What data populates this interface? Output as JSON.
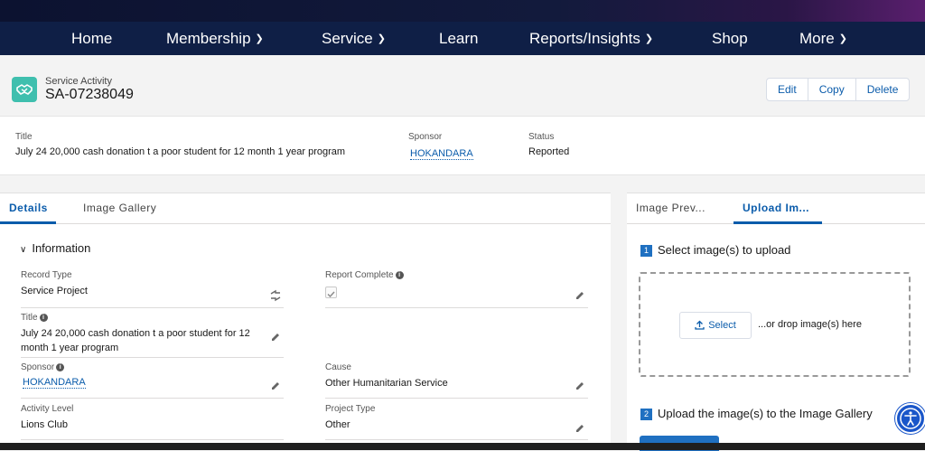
{
  "nav": {
    "items": [
      {
        "label": "Home",
        "dropdown": false
      },
      {
        "label": "Membership",
        "dropdown": true
      },
      {
        "label": "Service",
        "dropdown": true
      },
      {
        "label": "Learn",
        "dropdown": false
      },
      {
        "label": "Reports/Insights",
        "dropdown": true
      },
      {
        "label": "Shop",
        "dropdown": false
      },
      {
        "label": "More",
        "dropdown": true
      }
    ]
  },
  "record": {
    "type_label": "Service Activity",
    "id": "SA-07238049",
    "icon": "handshake-icon",
    "actions": [
      "Edit",
      "Copy",
      "Delete"
    ]
  },
  "highlights": {
    "title_label": "Title",
    "title_value": "July 24 20,000 cash donation t a poor student for 12 month 1 year program",
    "sponsor_label": "Sponsor",
    "sponsor_value": "HOKANDARA",
    "status_label": "Status",
    "status_value": "Reported"
  },
  "details": {
    "tabs": [
      "Details",
      "Image Gallery"
    ],
    "active_tab": "Details",
    "section_title": "Information",
    "fields": {
      "record_type_label": "Record Type",
      "record_type_value": "Service Project",
      "report_complete_label": "Report Complete",
      "report_complete_checked": true,
      "title_label": "Title",
      "title_value_line1": "July 24 20,000 cash donation t a poor student for 12",
      "title_value_line2": "month 1 year program",
      "sponsor_label": "Sponsor",
      "sponsor_value": "HOKANDARA",
      "cause_label": "Cause",
      "cause_value": "Other Humanitarian Service",
      "activity_level_label": "Activity Level",
      "activity_level_value": "Lions Club",
      "project_type_label": "Project Type",
      "project_type_value": "Other"
    }
  },
  "upload": {
    "tabs": [
      "Image Prev...",
      "Upload Im..."
    ],
    "active_tab": "Upload Im...",
    "step1_num": "1",
    "step1_label": "Select image(s) to upload",
    "select_label": "Select",
    "drop_text": "...or drop image(s) here",
    "step2_num": "2",
    "step2_label": "Upload the image(s) to the Image Gallery"
  },
  "colors": {
    "nav_bg": "#0f1f46",
    "link": "#0b5cab",
    "record_icon": "#3fbfae",
    "step_badge": "#1f70c1",
    "accessibility": "#1a56c9"
  }
}
